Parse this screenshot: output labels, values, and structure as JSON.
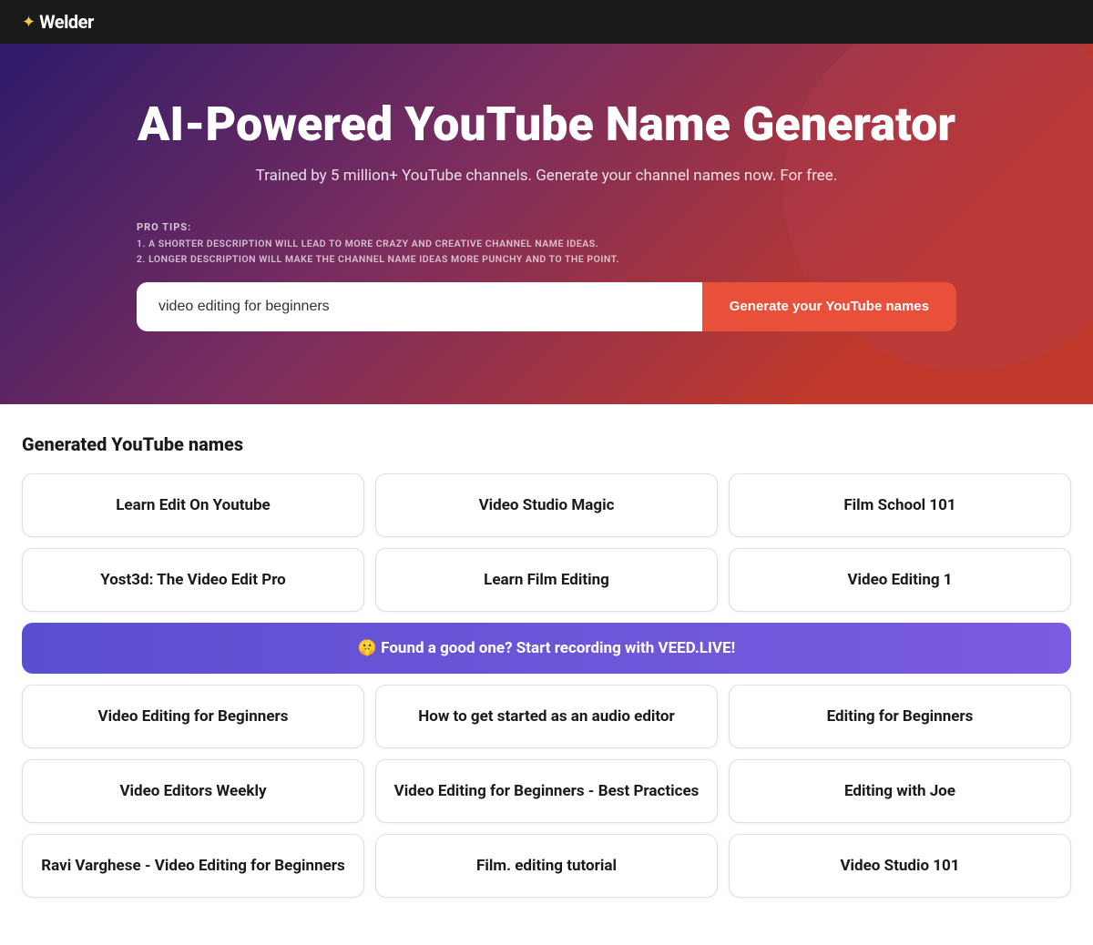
{
  "header": {
    "logo": "✦",
    "logo_text": "Welder"
  },
  "hero": {
    "title": "AI-Powered YouTube Name Generator",
    "subtitle": "Trained by 5 million+ YouTube channels. Generate your channel names now. For free.",
    "pro_tips_label": "PRO TIPS:",
    "pro_tips": [
      "1. A SHORTER DESCRIPTION WILL LEAD TO MORE CRAZY AND CREATIVE CHANNEL NAME IDEAS.",
      "2. LONGER DESCRIPTION WILL MAKE THE CHANNEL NAME IDEAS MORE PUNCHY AND TO THE POINT."
    ],
    "input_value": "video editing for beginners",
    "input_placeholder": "video editing for beginners",
    "button_label": "Generate your YouTube names"
  },
  "results": {
    "title": "Generated YouTube names",
    "row1": [
      "Learn Edit On Youtube",
      "Video Studio Magic",
      "Film School 101"
    ],
    "row2": [
      "Yost3d: The Video Edit Pro",
      "Learn Film Editing",
      "Video Editing 1"
    ],
    "banner": "🤫 Found a good one? Start recording with VEED.LIVE!",
    "row3": [
      "Video Editing for Beginners",
      "How to get started as an audio editor",
      "Editing for Beginners"
    ],
    "row4": [
      "Video Editors Weekly",
      "Video Editing for Beginners - Best Practices",
      "Editing with Joe"
    ],
    "row5": [
      "Ravi Varghese - Video Editing for Beginners",
      "Film. editing tutorial",
      "Video Studio 101"
    ]
  }
}
